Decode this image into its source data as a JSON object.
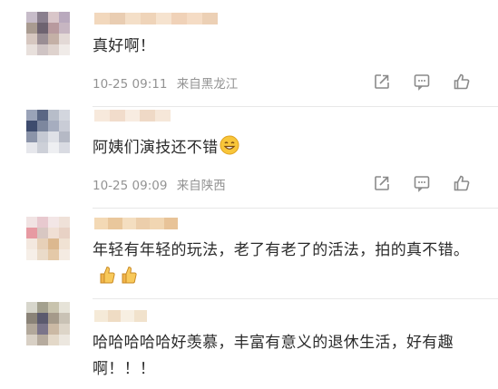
{
  "comments": [
    {
      "text": "真好啊！",
      "time": "10-25 09:11",
      "location": "来自黑龙江",
      "emoji": ""
    },
    {
      "text": "阿姨们演技还不错",
      "time": "10-25 09:09",
      "location": "来自陕西",
      "emoji": "smile-emoji"
    },
    {
      "text": "年轻有年轻的玩法，老了有老了的活法，拍的真不错。",
      "time": "",
      "location": "",
      "emoji": "thumbs-up-emoji"
    },
    {
      "text": "哈哈哈哈哈好羡慕，丰富有意义的退休生活，好有趣啊！！！",
      "time": "",
      "location": "",
      "emoji": ""
    }
  ],
  "icons": {
    "share": "share-icon",
    "comment": "comment-icon",
    "like": "like-icon"
  }
}
